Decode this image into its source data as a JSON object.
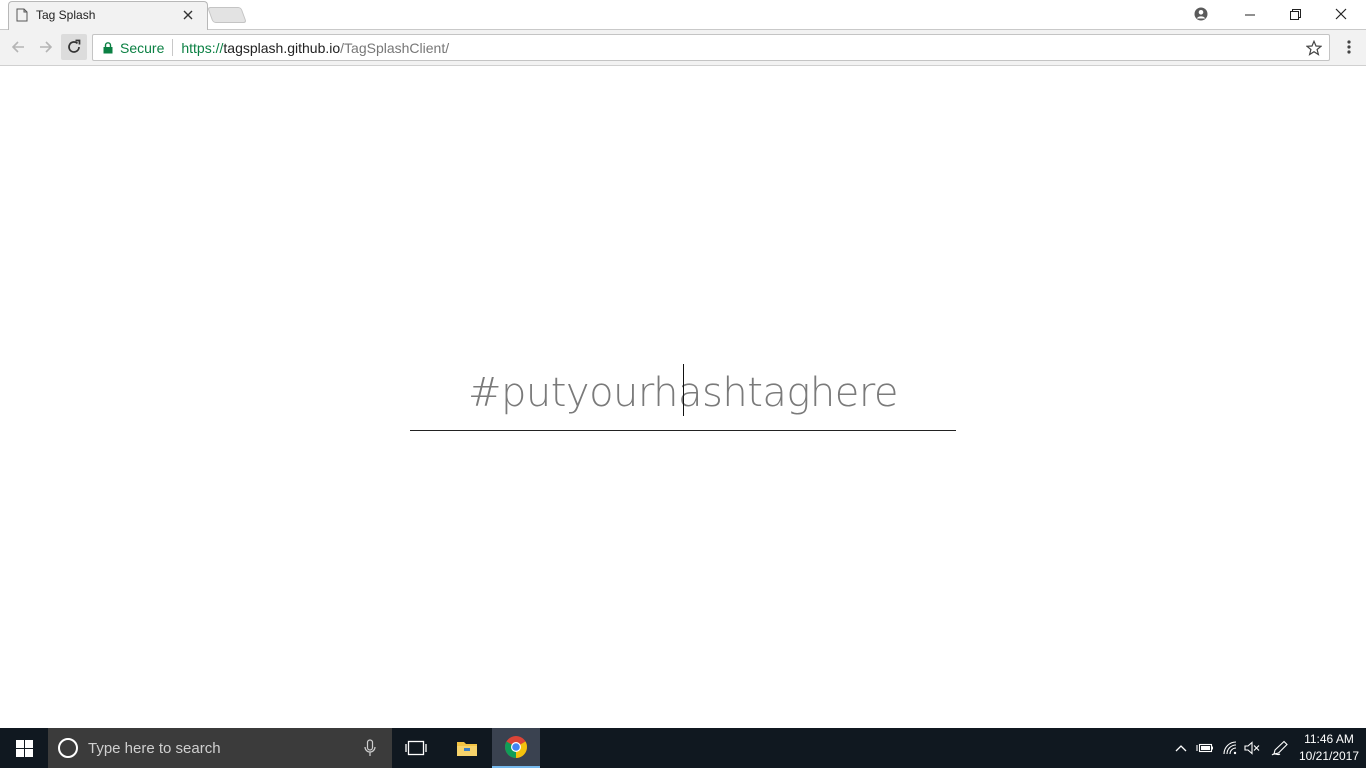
{
  "browser": {
    "tab": {
      "title": "Tag Splash"
    },
    "address_bar": {
      "security_label": "Secure",
      "url_scheme": "https://",
      "url_host": "tagsplash.github.io",
      "url_path": "/TagSplashClient/"
    }
  },
  "page": {
    "hashtag_input": {
      "placeholder": "#putyourhashtaghere",
      "value": ""
    }
  },
  "taskbar": {
    "search_placeholder": "Type here to search",
    "clock": {
      "time": "11:46 AM",
      "date": "10/21/2017"
    }
  },
  "colors": {
    "secure_green": "#0b8043",
    "taskbar_bg": "#101820",
    "search_bg": "#3b3b3b",
    "active_underline": "#76b9ed"
  }
}
